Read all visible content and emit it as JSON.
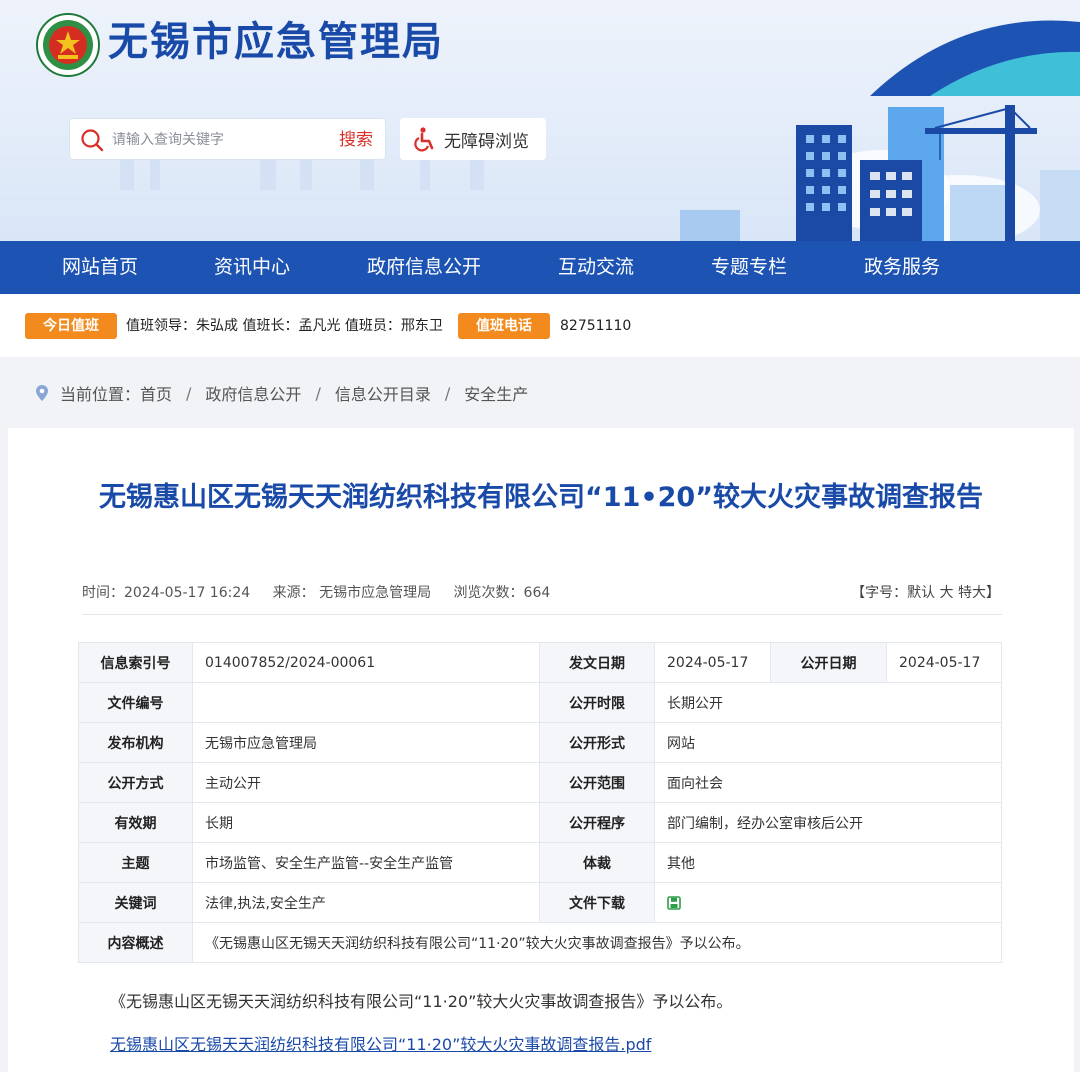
{
  "header": {
    "site_title": "无锡市应急管理局",
    "search_placeholder": "请输入查询关键字",
    "search_button": "搜索",
    "accessibility": "无障碍浏览"
  },
  "nav": [
    "网站首页",
    "资讯中心",
    "政府信息公开",
    "互动交流",
    "专题专栏",
    "政务服务"
  ],
  "duty": {
    "today_tag": "今日值班",
    "today_text": "值班领导：朱弘成 值班长：孟凡光 值班员：邢东卫",
    "phone_tag": "值班电话",
    "phone": "82751110"
  },
  "breadcrumb": {
    "prefix": "当前位置：",
    "items": [
      "首页",
      "政府信息公开",
      "信息公开目录",
      "安全生产"
    ]
  },
  "article": {
    "title": "无锡惠山区无锡天天润纺织科技有限公司“11•20”较大火灾事故调查报告",
    "time": "时间：2024-05-17 16:24",
    "source": "来源： 无锡市应急管理局",
    "views": "浏览次数：664",
    "font_prefix": "【字号：",
    "font_default": "默认",
    "font_large": "大",
    "font_xlarge": "特大",
    "font_suffix": "】",
    "summary": "《无锡惠山区无锡天天润纺织科技有限公司“11·20”较大火灾事故调查报告》予以公布。",
    "file_link": "无锡惠山区无锡天天润纺织科技有限公司“11·20”较大火灾事故调查报告.pdf"
  },
  "info": {
    "index_label": "信息索引号",
    "index_value": "014007852/2024-00061",
    "issue_date_label": "发文日期",
    "issue_date_value": "2024-05-17",
    "public_date_label": "公开日期",
    "public_date_value": "2024-05-17",
    "doc_no_label": "文件编号",
    "doc_no_value": "",
    "period_label": "公开时限",
    "period_value": "长期公开",
    "org_label": "发布机构",
    "org_value": "无锡市应急管理局",
    "form_label": "公开形式",
    "form_value": "网站",
    "mode_label": "公开方式",
    "mode_value": "主动公开",
    "scope_label": "公开范围",
    "scope_value": "面向社会",
    "validity_label": "有效期",
    "validity_value": "长期",
    "procedure_label": "公开程序",
    "procedure_value": "部门编制，经办公室审核后公开",
    "topic_label": "主题",
    "topic_value": "市场监管、安全生产监管--安全生产监管",
    "genre_label": "体裁",
    "genre_value": "其他",
    "keywords_label": "关键词",
    "keywords_value": "法律,执法,安全生产",
    "download_label": "文件下载",
    "overview_label": "内容概述",
    "overview_value": "《无锡惠山区无锡天天润纺织科技有限公司“11·20”较大火灾事故调查报告》予以公布。"
  },
  "colors": {
    "brand": "#1d53b3",
    "title": "#1a4aa8",
    "accent": "#f38a1d",
    "search": "#d9302b"
  }
}
